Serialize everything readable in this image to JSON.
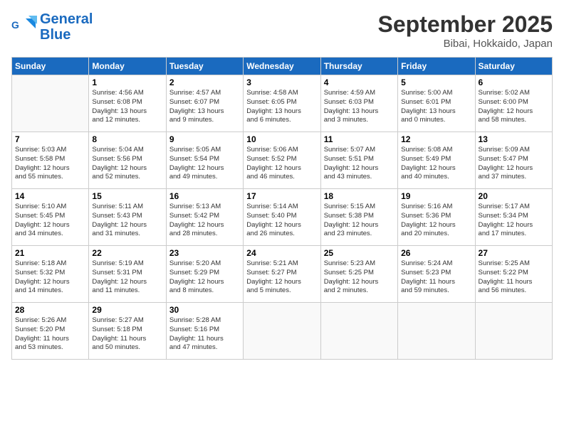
{
  "header": {
    "logo_line1": "General",
    "logo_line2": "Blue",
    "month_title": "September 2025",
    "location": "Bibai, Hokkaido, Japan"
  },
  "columns": [
    "Sunday",
    "Monday",
    "Tuesday",
    "Wednesday",
    "Thursday",
    "Friday",
    "Saturday"
  ],
  "weeks": [
    [
      {
        "day": "",
        "info": ""
      },
      {
        "day": "1",
        "info": "Sunrise: 4:56 AM\nSunset: 6:08 PM\nDaylight: 13 hours\nand 12 minutes."
      },
      {
        "day": "2",
        "info": "Sunrise: 4:57 AM\nSunset: 6:07 PM\nDaylight: 13 hours\nand 9 minutes."
      },
      {
        "day": "3",
        "info": "Sunrise: 4:58 AM\nSunset: 6:05 PM\nDaylight: 13 hours\nand 6 minutes."
      },
      {
        "day": "4",
        "info": "Sunrise: 4:59 AM\nSunset: 6:03 PM\nDaylight: 13 hours\nand 3 minutes."
      },
      {
        "day": "5",
        "info": "Sunrise: 5:00 AM\nSunset: 6:01 PM\nDaylight: 13 hours\nand 0 minutes."
      },
      {
        "day": "6",
        "info": "Sunrise: 5:02 AM\nSunset: 6:00 PM\nDaylight: 12 hours\nand 58 minutes."
      }
    ],
    [
      {
        "day": "7",
        "info": "Sunrise: 5:03 AM\nSunset: 5:58 PM\nDaylight: 12 hours\nand 55 minutes."
      },
      {
        "day": "8",
        "info": "Sunrise: 5:04 AM\nSunset: 5:56 PM\nDaylight: 12 hours\nand 52 minutes."
      },
      {
        "day": "9",
        "info": "Sunrise: 5:05 AM\nSunset: 5:54 PM\nDaylight: 12 hours\nand 49 minutes."
      },
      {
        "day": "10",
        "info": "Sunrise: 5:06 AM\nSunset: 5:52 PM\nDaylight: 12 hours\nand 46 minutes."
      },
      {
        "day": "11",
        "info": "Sunrise: 5:07 AM\nSunset: 5:51 PM\nDaylight: 12 hours\nand 43 minutes."
      },
      {
        "day": "12",
        "info": "Sunrise: 5:08 AM\nSunset: 5:49 PM\nDaylight: 12 hours\nand 40 minutes."
      },
      {
        "day": "13",
        "info": "Sunrise: 5:09 AM\nSunset: 5:47 PM\nDaylight: 12 hours\nand 37 minutes."
      }
    ],
    [
      {
        "day": "14",
        "info": "Sunrise: 5:10 AM\nSunset: 5:45 PM\nDaylight: 12 hours\nand 34 minutes."
      },
      {
        "day": "15",
        "info": "Sunrise: 5:11 AM\nSunset: 5:43 PM\nDaylight: 12 hours\nand 31 minutes."
      },
      {
        "day": "16",
        "info": "Sunrise: 5:13 AM\nSunset: 5:42 PM\nDaylight: 12 hours\nand 28 minutes."
      },
      {
        "day": "17",
        "info": "Sunrise: 5:14 AM\nSunset: 5:40 PM\nDaylight: 12 hours\nand 26 minutes."
      },
      {
        "day": "18",
        "info": "Sunrise: 5:15 AM\nSunset: 5:38 PM\nDaylight: 12 hours\nand 23 minutes."
      },
      {
        "day": "19",
        "info": "Sunrise: 5:16 AM\nSunset: 5:36 PM\nDaylight: 12 hours\nand 20 minutes."
      },
      {
        "day": "20",
        "info": "Sunrise: 5:17 AM\nSunset: 5:34 PM\nDaylight: 12 hours\nand 17 minutes."
      }
    ],
    [
      {
        "day": "21",
        "info": "Sunrise: 5:18 AM\nSunset: 5:32 PM\nDaylight: 12 hours\nand 14 minutes."
      },
      {
        "day": "22",
        "info": "Sunrise: 5:19 AM\nSunset: 5:31 PM\nDaylight: 12 hours\nand 11 minutes."
      },
      {
        "day": "23",
        "info": "Sunrise: 5:20 AM\nSunset: 5:29 PM\nDaylight: 12 hours\nand 8 minutes."
      },
      {
        "day": "24",
        "info": "Sunrise: 5:21 AM\nSunset: 5:27 PM\nDaylight: 12 hours\nand 5 minutes."
      },
      {
        "day": "25",
        "info": "Sunrise: 5:23 AM\nSunset: 5:25 PM\nDaylight: 12 hours\nand 2 minutes."
      },
      {
        "day": "26",
        "info": "Sunrise: 5:24 AM\nSunset: 5:23 PM\nDaylight: 11 hours\nand 59 minutes."
      },
      {
        "day": "27",
        "info": "Sunrise: 5:25 AM\nSunset: 5:22 PM\nDaylight: 11 hours\nand 56 minutes."
      }
    ],
    [
      {
        "day": "28",
        "info": "Sunrise: 5:26 AM\nSunset: 5:20 PM\nDaylight: 11 hours\nand 53 minutes."
      },
      {
        "day": "29",
        "info": "Sunrise: 5:27 AM\nSunset: 5:18 PM\nDaylight: 11 hours\nand 50 minutes."
      },
      {
        "day": "30",
        "info": "Sunrise: 5:28 AM\nSunset: 5:16 PM\nDaylight: 11 hours\nand 47 minutes."
      },
      {
        "day": "",
        "info": ""
      },
      {
        "day": "",
        "info": ""
      },
      {
        "day": "",
        "info": ""
      },
      {
        "day": "",
        "info": ""
      }
    ]
  ]
}
